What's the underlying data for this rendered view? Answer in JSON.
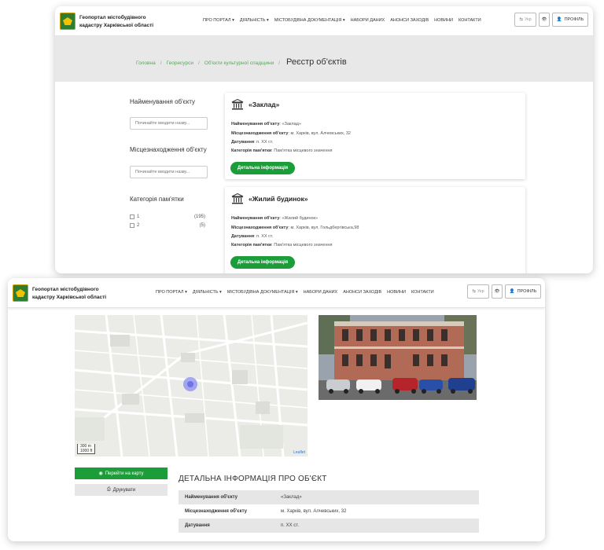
{
  "header": {
    "brand_line1": "Геопортал містобудівного",
    "brand_line2": "кадастру Харківської області",
    "nav": [
      "ПРО ПОРТАЛ ▾",
      "ДІЯЛЬНІСТЬ ▾",
      "МІСТОБУДІВНА ДОКУМЕНТАЦІЯ ▾",
      "НАБОРИ ДАНИХ",
      "АНОНСИ ЗАХОДІВ",
      "НОВИНИ",
      "КОНТАКТИ"
    ],
    "lang": "Укр",
    "profile": "ПРОФІЛЬ"
  },
  "breadcrumbs": {
    "home": "Головна",
    "geo": "Георесурси",
    "heritage": "Об'єкти культурної спадщини",
    "current": "Реєстр об'єктів"
  },
  "filters": {
    "name_label": "Найменування об'єкту",
    "name_placeholder": "Починайте вводити назву...",
    "location_label": "Місцезнаходження об'єкту",
    "location_placeholder": "Починайте вводити назву...",
    "category_label": "Категорія пам'ятки",
    "categories": [
      {
        "label": "1",
        "count": "(195)"
      },
      {
        "label": "2",
        "count": "(5)"
      }
    ]
  },
  "cards": [
    {
      "title": "«Заклад»",
      "name_key": "Найменування об'єкту",
      "name_val": "«Заклад»",
      "loc_key": "Місцезнаходження об'єкту",
      "loc_val": "м. Харків, вул. Алчевських, 32",
      "date_key": "Датування",
      "date_val": "п. XX ст.",
      "cat_key": "Категорія пам'ятки",
      "cat_val": "Пам'ятка місцевого значення",
      "button": "Детальна інформація"
    },
    {
      "title": "«Жилий будинок»",
      "name_key": "Найменування об'єкту",
      "name_val": "«Жилий будинок»",
      "loc_key": "Місцезнаходження об'єкту",
      "loc_val": "м. Харків, вул. Гольдбергівська,98",
      "date_key": "Датування",
      "date_val": "п. XX ст.",
      "cat_key": "Категорія пам'ятки",
      "cat_val": "Пам'ятка місцевого значення",
      "button": "Детальна інформація"
    }
  ],
  "detail": {
    "map_scale_m": "300 m",
    "map_scale_ft": "1000 ft",
    "map_attrib": "Leaflet",
    "goto_map": "Перейти на карту",
    "print": "Друкувати",
    "heading": "ДЕТАЛЬНА ІНФОРМАЦІЯ ПРО ОБ'ЄКТ",
    "rows": [
      {
        "k": "Найменування об'єкту",
        "v": "«Заклад»"
      },
      {
        "k": "Місцезнаходження об'єкту",
        "v": "м. Харків, вул. Алчевських, 32"
      },
      {
        "k": "Датування",
        "v": "п. XX ст."
      }
    ]
  }
}
